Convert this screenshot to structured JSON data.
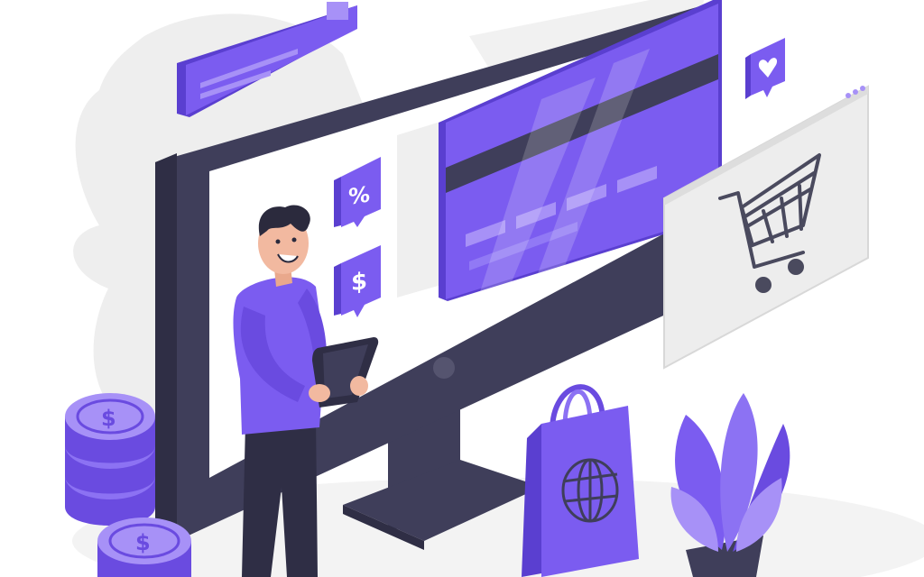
{
  "scene": "online-shopping-illustration",
  "icons": {
    "percent_badge": "percent-icon",
    "dollar_badge": "dollar-icon",
    "heart_badge": "heart-icon",
    "cart": "shopping-cart-icon",
    "globe": "globe-icon"
  },
  "badges": {
    "percent_symbol": "%",
    "dollar_symbol": "$",
    "coin_symbol": "$"
  },
  "colors": {
    "accent": "#7B5CF0",
    "accent_dark": "#6A4BE0",
    "accent_light": "#A791F7",
    "monitor_dark": "#3F3E5A",
    "monitor_mid": "#55546F",
    "screen_bg": "#FFFFFF",
    "background_shape": "#EEEEEE",
    "cart_gray": "#4A4A5E",
    "skin": "#F2B9A0",
    "hair": "#2B2A3D"
  }
}
